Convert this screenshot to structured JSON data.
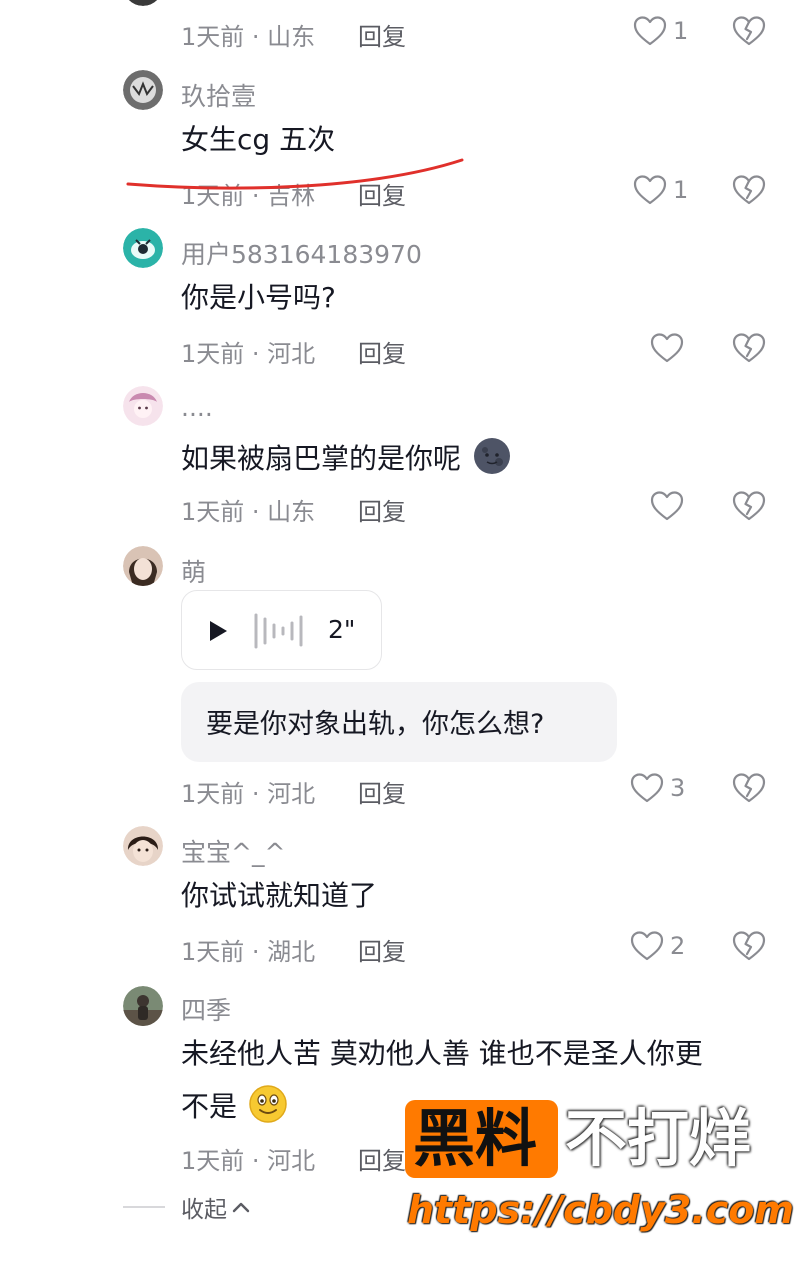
{
  "comments": [
    {
      "meta": "1天前 · 山东",
      "reply": "回复",
      "likes": "1"
    },
    {
      "username": "玖拾壹",
      "text": "女生cg 五次",
      "meta": "1天前 · 吉林",
      "reply": "回复",
      "likes": "1"
    },
    {
      "username": "用户583164183970",
      "text": "你是小号吗?",
      "meta": "1天前 · 河北",
      "reply": "回复",
      "likes": ""
    },
    {
      "username": "....",
      "text": "如果被扇巴掌的是你呢",
      "meta": "1天前 · 山东",
      "reply": "回复",
      "likes": ""
    },
    {
      "username": "萌",
      "voice_duration": "2\"",
      "quote": "要是你对象出轨，你怎么想?",
      "meta": "1天前 · 河北",
      "reply": "回复",
      "likes": "3"
    },
    {
      "username": "宝宝^_^",
      "text": "你试试就知道了",
      "meta": "1天前 · 湖北",
      "reply": "回复",
      "likes": "2"
    },
    {
      "username": "四季",
      "text_line1": "未经他人苦  莫劝他人善 谁也不是圣人你更",
      "text_line2": "不是",
      "meta": "1天前 · 河北",
      "reply": "回复",
      "likes": ""
    }
  ],
  "collapse_label": "收起",
  "watermark": {
    "brand": "黑料",
    "slogan": "不打烊",
    "url": "https://cbdy3.com"
  },
  "colors": {
    "annotation_red": "#e0302b",
    "watermark_orange": "#ff7a00"
  },
  "icons": [
    "heart-outline-icon",
    "broken-heart-icon",
    "play-icon",
    "waveform-icon",
    "chevron-up-icon"
  ]
}
